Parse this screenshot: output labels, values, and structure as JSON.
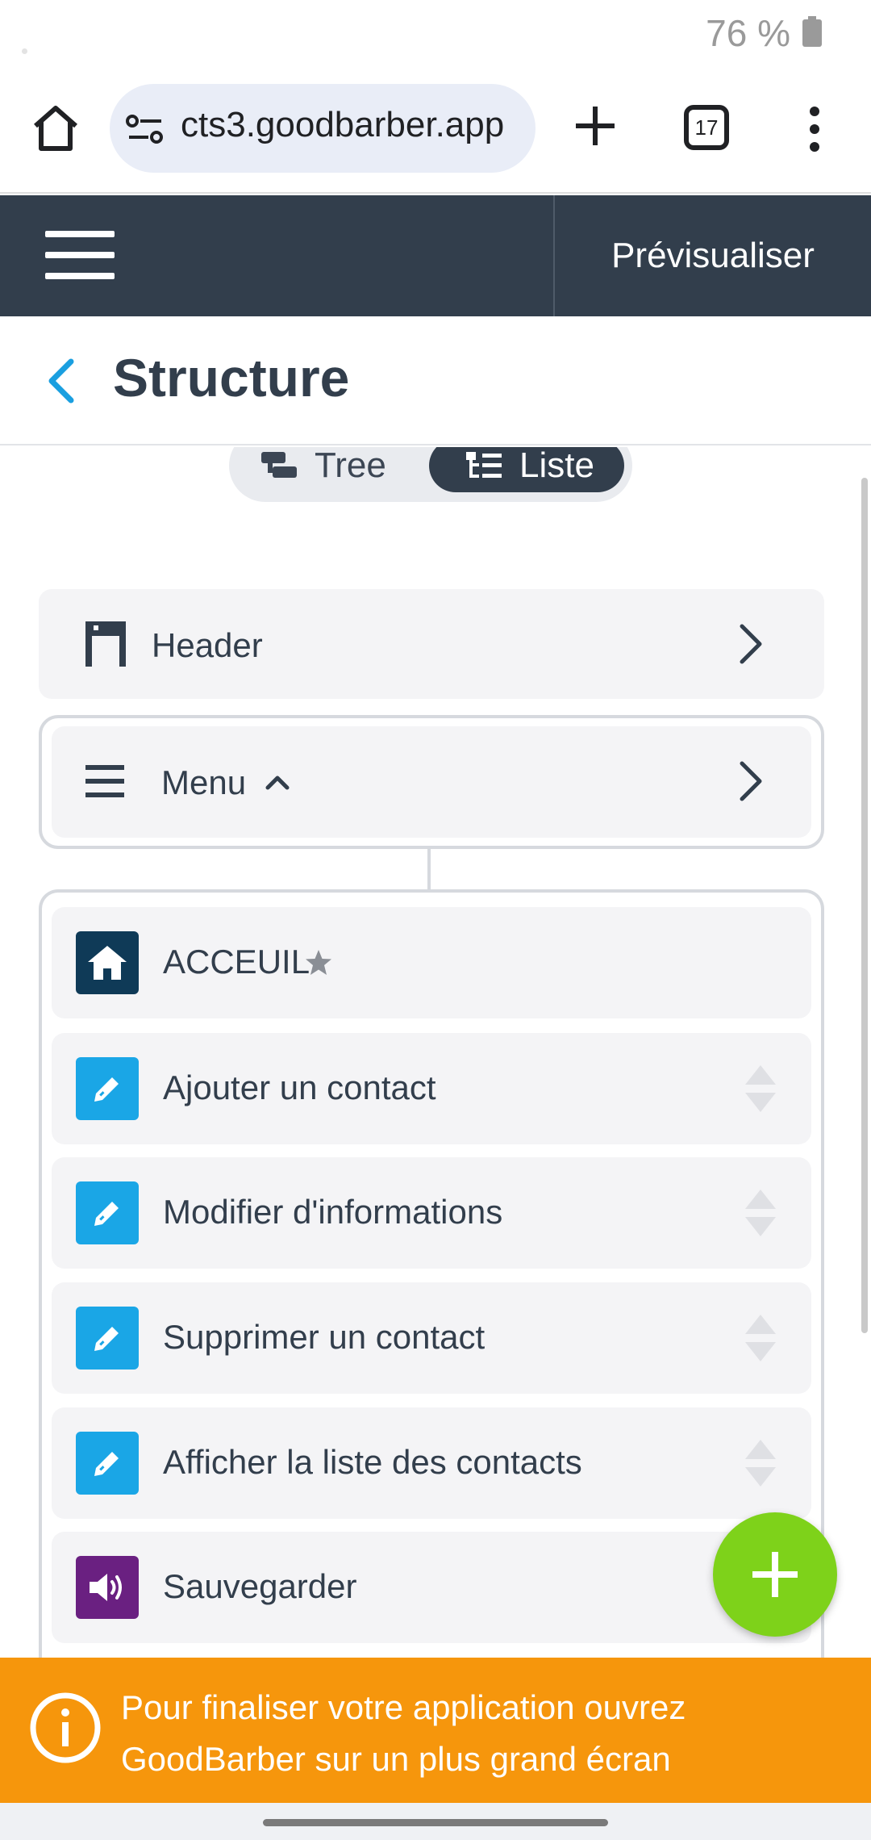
{
  "status_bar": {
    "battery": "76 %"
  },
  "browser": {
    "url": "cts3.goodbarber.app",
    "tab_count": "17"
  },
  "app_header": {
    "preview_label": "Prévisualiser"
  },
  "page": {
    "title": "Structure"
  },
  "view_toggle": {
    "tree_label": "Tree",
    "list_label": "Liste",
    "selected": "Liste"
  },
  "structure": {
    "header_label": "Header",
    "menu_label": "Menu",
    "pages": [
      {
        "label": "ACCEUIL",
        "icon": "home-icon",
        "color": "#0f3a57",
        "is_home": true
      },
      {
        "label": "Ajouter un contact",
        "icon": "pencil-icon",
        "color": "#1aa6e6"
      },
      {
        "label": "Modifier d'informations",
        "icon": "pencil-icon",
        "color": "#1aa6e6"
      },
      {
        "label": "Supprimer un contact",
        "icon": "pencil-icon",
        "color": "#1aa6e6"
      },
      {
        "label": "Afficher la liste des contacts",
        "icon": "pencil-icon",
        "color": "#1aa6e6"
      },
      {
        "label": "Sauvegarder",
        "icon": "speaker-icon",
        "color": "#6a2081"
      }
    ]
  },
  "banner": {
    "text": "Pour finaliser votre application ouvrez GoodBarber sur un plus grand écran"
  },
  "colors": {
    "dark": "#323e4c",
    "accent_blue": "#1aa6e6",
    "fab_green": "#7ed21a",
    "banner_orange": "#f6960c"
  }
}
